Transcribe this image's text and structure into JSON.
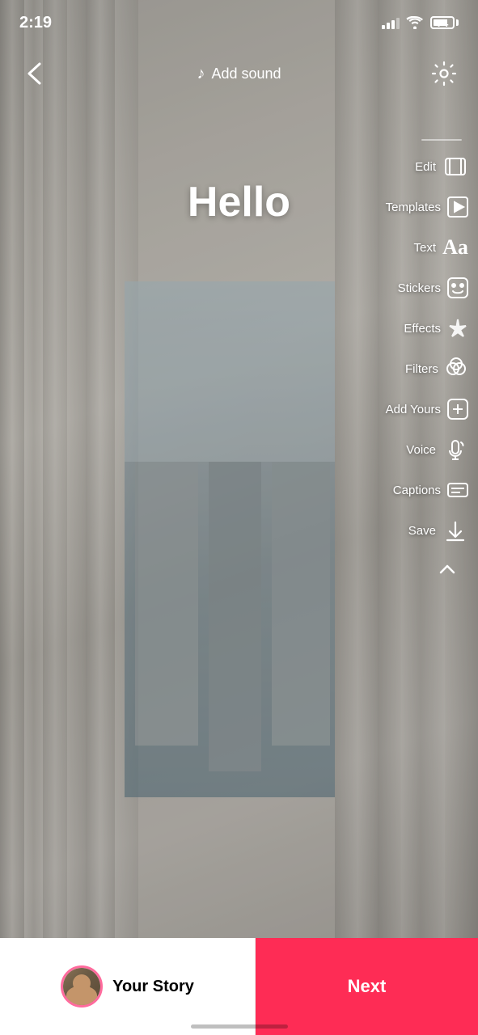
{
  "status": {
    "time": "2:19",
    "battery_level": "74"
  },
  "header": {
    "back_label": "back",
    "add_sound_label": "Add sound",
    "settings_label": "settings"
  },
  "canvas": {
    "hello_text": "Hello"
  },
  "toolbar": {
    "items": [
      {
        "id": "edit",
        "label": "Edit",
        "icon": "edit-icon"
      },
      {
        "id": "templates",
        "label": "Templates",
        "icon": "templates-icon"
      },
      {
        "id": "text",
        "label": "Text",
        "icon": "text-icon"
      },
      {
        "id": "stickers",
        "label": "Stickers",
        "icon": "stickers-icon"
      },
      {
        "id": "effects",
        "label": "Effects",
        "icon": "effects-icon"
      },
      {
        "id": "filters",
        "label": "Filters",
        "icon": "filters-icon"
      },
      {
        "id": "add-yours",
        "label": "Add Yours",
        "icon": "add-yours-icon"
      },
      {
        "id": "voice",
        "label": "Voice",
        "icon": "voice-icon"
      },
      {
        "id": "captions",
        "label": "Captions",
        "icon": "captions-icon"
      },
      {
        "id": "save",
        "label": "Save",
        "icon": "save-icon"
      }
    ]
  },
  "bottom": {
    "your_story_label": "Your Story",
    "next_label": "Next"
  }
}
